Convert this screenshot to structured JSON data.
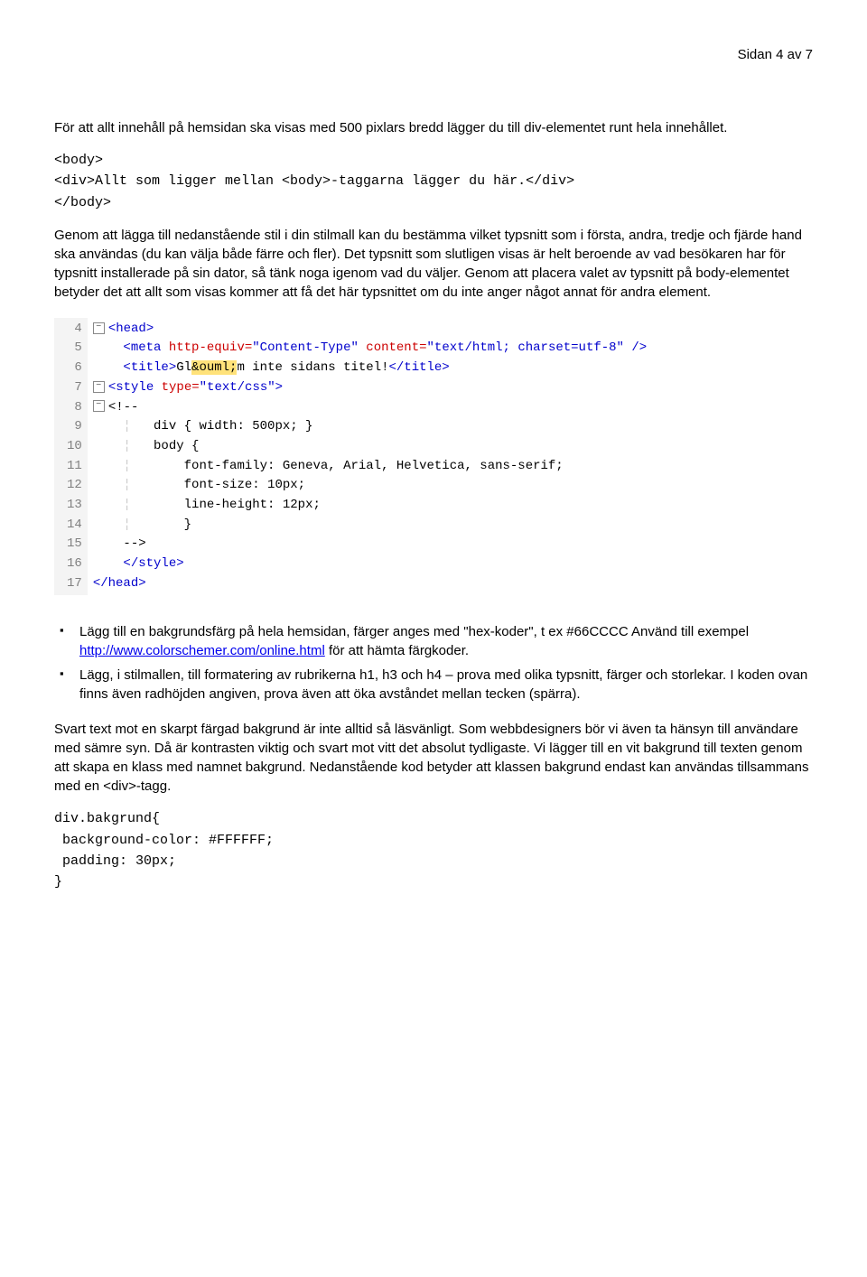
{
  "header": {
    "page_label": "Sidan 4 av 7"
  },
  "p1": "För att allt innehåll på hemsidan ska visas med 500 pixlars bredd lägger du till div-elementet runt hela innehållet.",
  "code1": {
    "l1": "<body>",
    "l2": "<div>Allt som ligger mellan <body>-taggarna lägger du här.</div>",
    "l3": "</body>"
  },
  "p2": "Genom att lägga till nedanstående stil i din stilmall kan du bestämma vilket typsnitt som i första, andra, tredje och fjärde hand ska användas (du kan välja både färre och fler). Det typsnitt som slutligen visas är helt beroende av vad besökaren har för typsnitt installerade på sin dator, så tänk noga igenom vad du väljer. Genom att placera valet av typsnitt på body-elementet betyder det att allt som visas kommer att få det här typsnittet om du inte anger något annat för andra element.",
  "editor": {
    "lines": [
      "4",
      "5",
      "6",
      "7",
      "8",
      "9",
      "10",
      "11",
      "12",
      "13",
      "14",
      "15",
      "16",
      "17"
    ],
    "row4": {
      "tag_open": "<head>"
    },
    "row5": {
      "tag": "<meta ",
      "a1": "http-equiv=",
      "v1": "\"Content-Type\"",
      "a2": " content=",
      "v2": "\"text/html; charset=utf-8\"",
      "end": " />"
    },
    "row6": {
      "open": "<title>",
      "t1": "Gl",
      "ent": "&ouml;",
      "t2": "m inte sidans titel!",
      "close": "</title>"
    },
    "row7": {
      "open": "<style ",
      "a": "type=",
      "v": "\"text/css\"",
      "end": ">"
    },
    "row8": "<!--",
    "row9": "div { width: 500px; }",
    "row10": "body {",
    "row11": "font-family: Geneva, Arial, Helvetica, sans-serif;",
    "row12": "font-size: 10px;",
    "row13": "line-height: 12px;",
    "row14": "}",
    "row15": "-->",
    "row16": "</style>",
    "row17": "</head>"
  },
  "bullets": {
    "b1a": "Lägg till en bakgrundsfärg på hela hemsidan, färger anges med \"hex-koder\", t ex #66CCCC Använd till exempel ",
    "b1_link": "http://www.colorschemer.com/online.html",
    "b1b": " för att hämta färgkoder.",
    "b2": "Lägg, i stilmallen, till formatering av rubrikerna h1, h3 och h4 – prova med olika typsnitt, färger och storlekar. I koden ovan finns även radhöjden angiven, prova även att öka avståndet mellan tecken (spärra)."
  },
  "p3": "Svart text mot en skarpt färgad bakgrund är inte alltid så läsvänligt. Som webbdesigners bör vi även ta hänsyn till användare med sämre syn. Då är kontrasten viktig och svart mot vitt det absolut tydligaste. Vi lägger till en vit bakgrund till texten genom att skapa en klass med namnet bakgrund. Nedanstående kod betyder att klassen bakgrund endast kan användas tillsammans med en <div>-tagg.",
  "code2": {
    "l1": "div.bakgrund{",
    "l2": " background-color: #FFFFFF;",
    "l3": " padding: 30px;",
    "l4": "}"
  }
}
